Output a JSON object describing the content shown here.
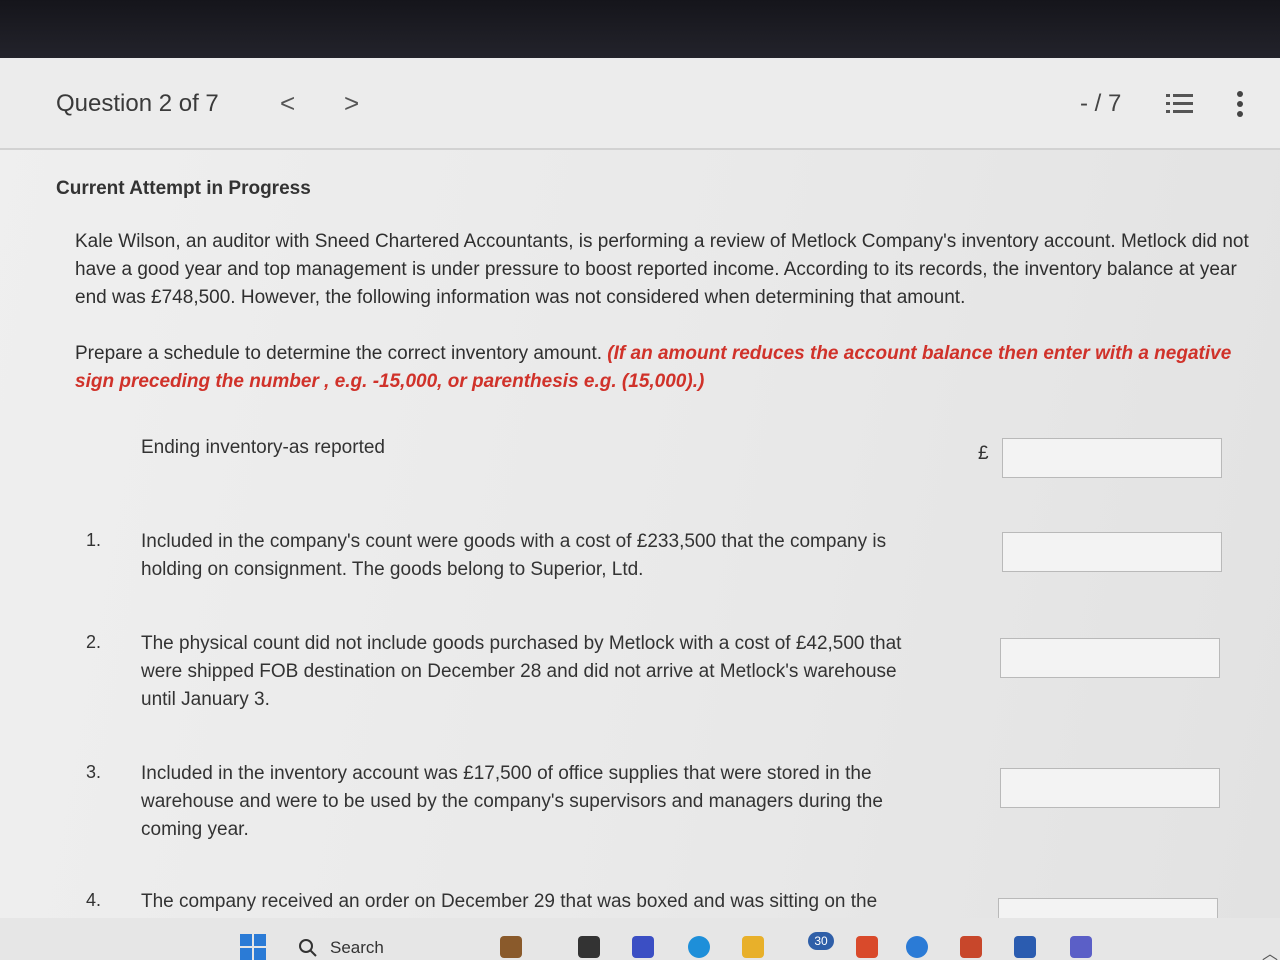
{
  "header": {
    "question_title": "Question 2 of 7",
    "prev_label": "<",
    "next_label": ">",
    "score": "- / 7",
    "list_icon": "list-icon",
    "more_icon": "more-vertical-icon"
  },
  "attempt_status": "Current Attempt in Progress",
  "intro_text": "Kale Wilson, an auditor with Sneed Chartered Accountants, is performing a review of Metlock Company's inventory account. Metlock did not have a good year and top management is under pressure to boost reported income. According to its records, the inventory balance at year end was £748,500. However, the following information was not considered when determining that amount.",
  "instructions": {
    "text": "Prepare a schedule to determine the correct inventory amount.",
    "note": "(If an amount reduces the account balance then enter with a negative sign preceding the number , e.g. -15,000, or parenthesis e.g. (15,000).)"
  },
  "schedule": {
    "ending_label": "Ending inventory-as reported",
    "currency": "£",
    "items": [
      {
        "num": "1.",
        "text": "Included in the company's count were goods with a cost of £233,500 that the company is holding on consignment. The goods belong to Superior, Ltd."
      },
      {
        "num": "2.",
        "text": "The physical count did not include goods purchased by Metlock with a cost of £42,500 that were shipped FOB destination on December 28 and did not arrive at Metlock's warehouse until January 3."
      },
      {
        "num": "3.",
        "text": "Included in the inventory account was £17,500 of office supplies that were stored in the warehouse and were to be used by the company's supervisors and managers during the coming year."
      },
      {
        "num": "4.",
        "text": "The company received an order on December 29 that was boxed and was sitting on the"
      }
    ],
    "inputs": [
      "",
      "",
      "",
      "",
      ""
    ]
  },
  "taskbar": {
    "search_label": "Search",
    "badge": "30"
  },
  "colors": {
    "accent_red": "#d0322a",
    "windows_blue": "#2b7bd6"
  }
}
